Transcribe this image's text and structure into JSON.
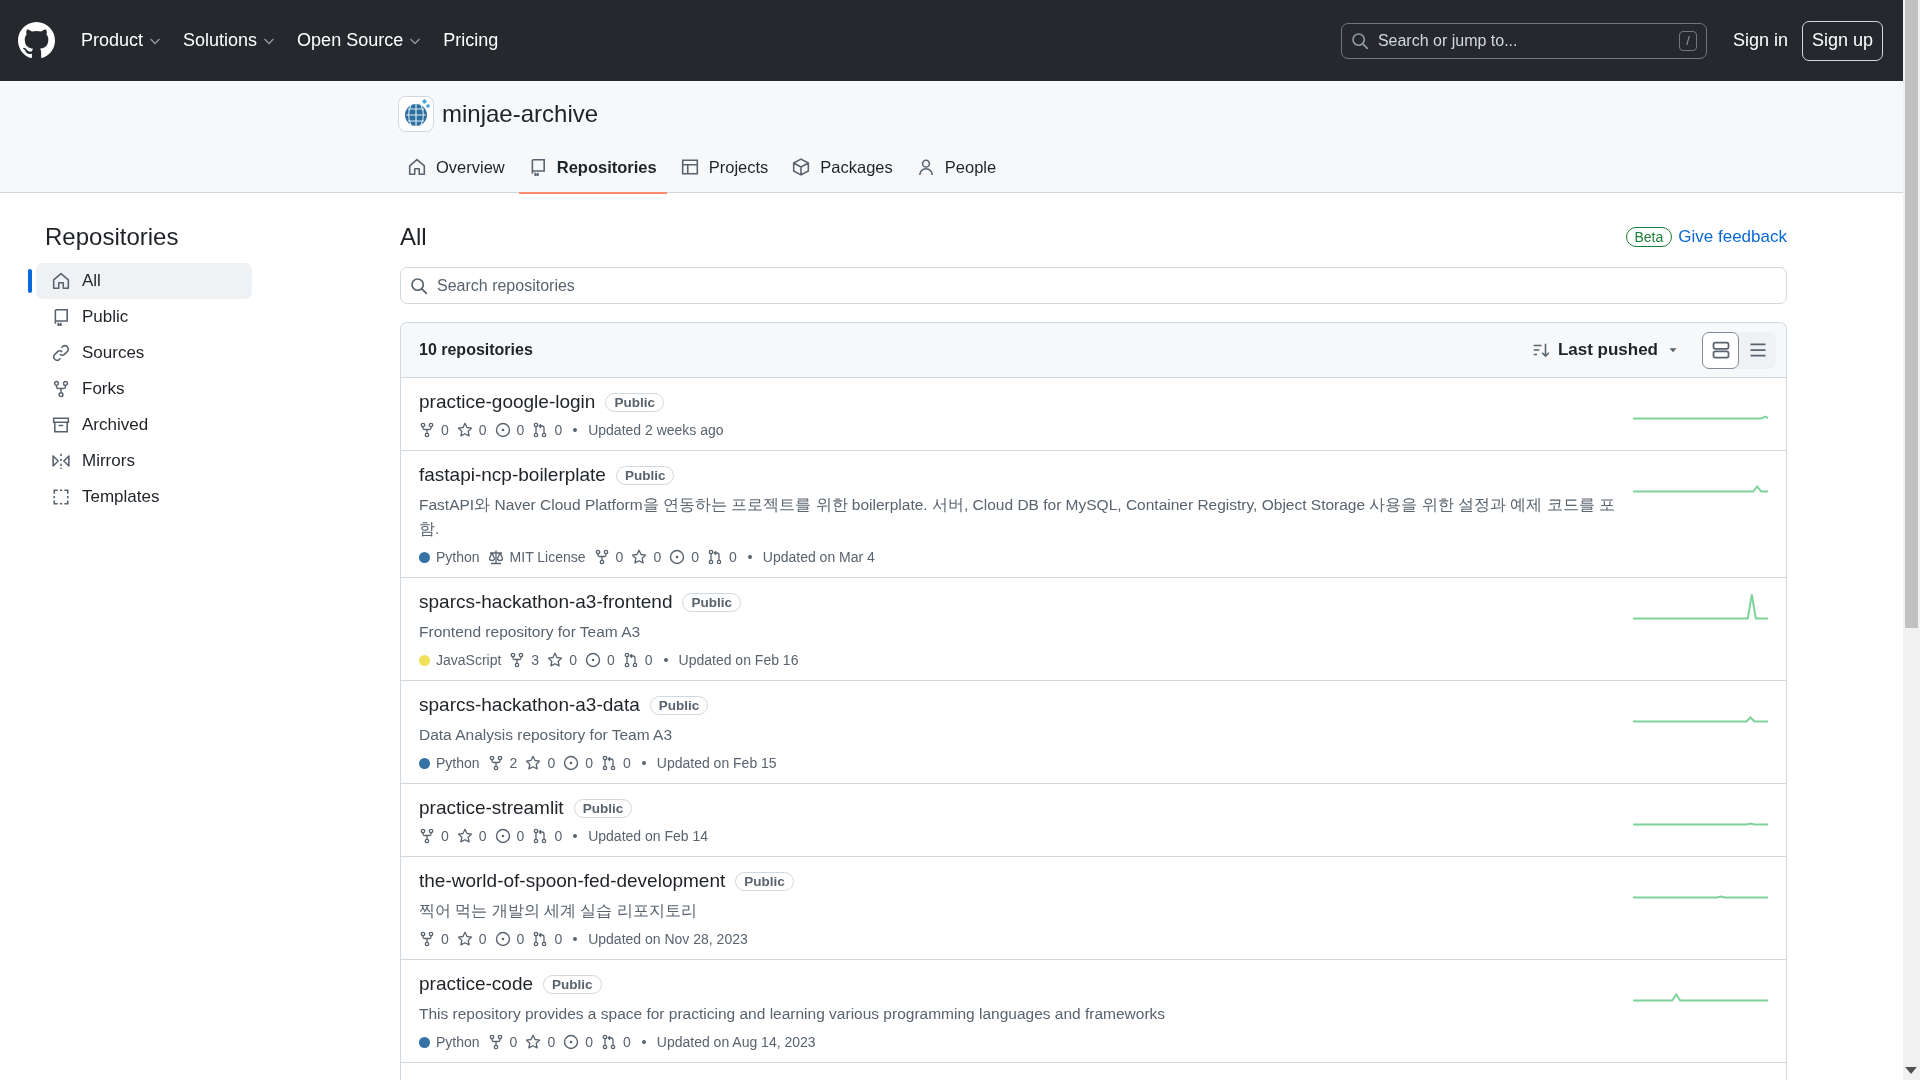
{
  "header": {
    "nav": [
      {
        "label": "Product",
        "dropdown": true
      },
      {
        "label": "Solutions",
        "dropdown": true
      },
      {
        "label": "Open Source",
        "dropdown": true
      },
      {
        "label": "Pricing",
        "dropdown": false
      }
    ],
    "search": {
      "placeholder": "Search or jump to...",
      "shortcut": "/"
    },
    "sign_in": "Sign in",
    "sign_up": "Sign up"
  },
  "org": {
    "name": "minjae-archive",
    "tabs": [
      {
        "label": "Overview",
        "kind": "home",
        "selected": false
      },
      {
        "label": "Repositories",
        "kind": "repo",
        "selected": true
      },
      {
        "label": "Projects",
        "kind": "table",
        "selected": false
      },
      {
        "label": "Packages",
        "kind": "package",
        "selected": false
      },
      {
        "label": "People",
        "kind": "person",
        "selected": false
      }
    ]
  },
  "sidebar": {
    "title": "Repositories",
    "items": [
      {
        "label": "All",
        "kind": "home",
        "selected": true
      },
      {
        "label": "Public",
        "kind": "repo",
        "selected": false
      },
      {
        "label": "Sources",
        "kind": "link",
        "selected": false
      },
      {
        "label": "Forks",
        "kind": "fork",
        "selected": false
      },
      {
        "label": "Archived",
        "kind": "archive",
        "selected": false
      },
      {
        "label": "Mirrors",
        "kind": "mirror",
        "selected": false
      },
      {
        "label": "Templates",
        "kind": "template",
        "selected": false
      }
    ]
  },
  "main": {
    "title": "All",
    "badge": "Beta",
    "feedback": "Give feedback",
    "search": {
      "placeholder": "Search repositories"
    },
    "list": {
      "count": "10 repositories",
      "sort": "Last pushed",
      "views": [
        {
          "kind": "cards",
          "selected": true
        },
        {
          "kind": "list",
          "selected": false
        }
      ],
      "repos": [
        {
          "name": "practice-google-login",
          "visibility": "Public",
          "forks": "0",
          "stars": "0",
          "issues": "0",
          "pulls": "0",
          "updated": "Updated 2 weeks ago"
        },
        {
          "name": "fastapi-ncp-boilerplate",
          "visibility": "Public",
          "description": "FastAPI와 Naver Cloud Platform을 연동하는 프로젝트를 위한 boilerplate. 서버, Cloud DB for MySQL, Container Registry, Object Storage 사용을 위한 설정과 예제 코드를 포함.",
          "language": {
            "name": "Python",
            "color": "#3572a5"
          },
          "license": "MIT License",
          "forks": "0",
          "stars": "0",
          "issues": "0",
          "pulls": "0",
          "updated": "Updated on Mar 4"
        },
        {
          "name": "sparcs-hackathon-a3-frontend",
          "visibility": "Public",
          "description": "Frontend repository for Team A3",
          "language": {
            "name": "JavaScript",
            "color": "#f1e05a"
          },
          "forks": "3",
          "stars": "0",
          "issues": "0",
          "pulls": "0",
          "updated": "Updated on Feb 16"
        },
        {
          "name": "sparcs-hackathon-a3-data",
          "visibility": "Public",
          "description": "Data Analysis repository for Team A3",
          "language": {
            "name": "Python",
            "color": "#3572a5"
          },
          "forks": "2",
          "stars": "0",
          "issues": "0",
          "pulls": "0",
          "updated": "Updated on Feb 15"
        },
        {
          "name": "practice-streamlit",
          "visibility": "Public",
          "forks": "0",
          "stars": "0",
          "issues": "0",
          "pulls": "0",
          "updated": "Updated on Feb 14"
        },
        {
          "name": "the-world-of-spoon-fed-development",
          "visibility": "Public",
          "description": "찍어 먹는 개발의 세계 실습 리포지토리",
          "forks": "0",
          "stars": "0",
          "issues": "0",
          "pulls": "0",
          "updated": "Updated on Nov 28, 2023"
        },
        {
          "name": "practice-code",
          "visibility": "Public",
          "description": "This repository provides a space for practicing and learning various programming languages and frameworks",
          "language": {
            "name": "Python",
            "color": "#3572a5"
          },
          "forks": "0",
          "stars": "0",
          "issues": "0",
          "pulls": "0",
          "updated": "Updated on Aug 14, 2023"
        }
      ]
    }
  }
}
